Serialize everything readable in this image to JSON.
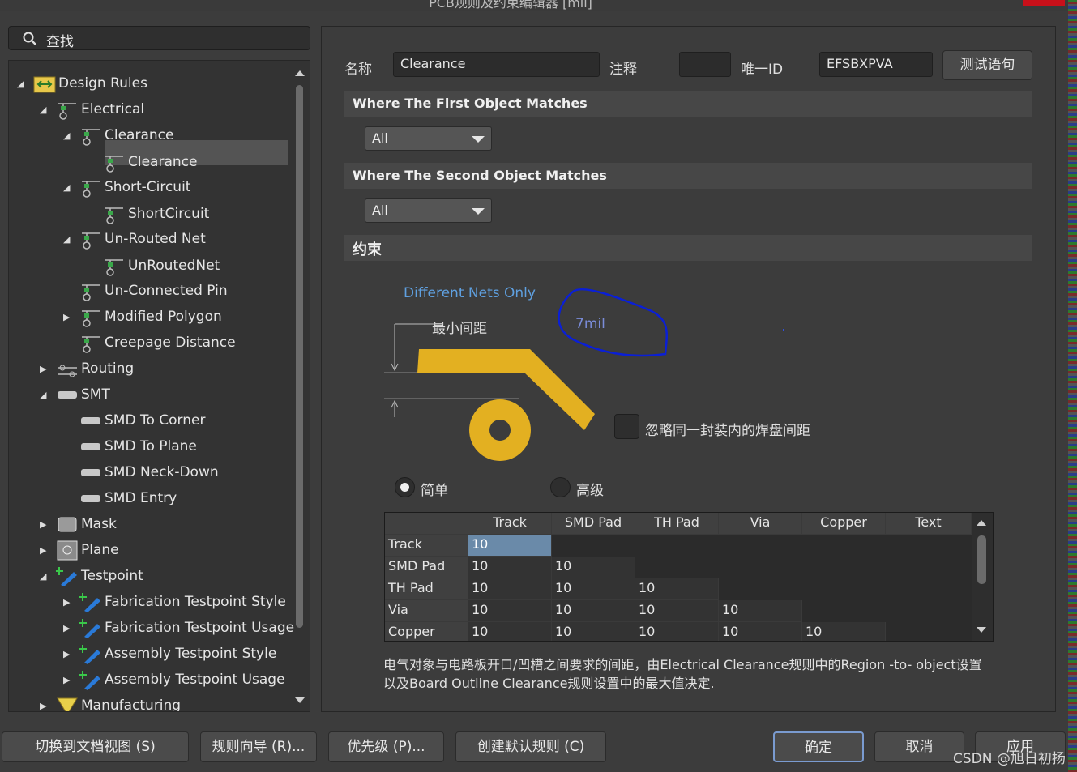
{
  "window": {
    "title": "PCB规则及约束编辑器 [mil]"
  },
  "search": {
    "label": "查找"
  },
  "tree": [
    {
      "label": "Design Rules",
      "icon": "design-rules-icon",
      "state": "expanded"
    },
    {
      "label": "Electrical",
      "icon": "rule-icon",
      "state": "expanded"
    },
    {
      "label": "Clearance",
      "icon": "rule-icon",
      "state": "expanded"
    },
    {
      "label": "Clearance",
      "icon": "rule-icon",
      "state": "leaf",
      "selected": true
    },
    {
      "label": "Short-Circuit",
      "icon": "rule-icon",
      "state": "expanded"
    },
    {
      "label": "ShortCircuit",
      "icon": "rule-icon",
      "state": "leaf"
    },
    {
      "label": "Un-Routed Net",
      "icon": "rule-icon",
      "state": "expanded"
    },
    {
      "label": "UnRoutedNet",
      "icon": "rule-icon",
      "state": "leaf"
    },
    {
      "label": "Un-Connected Pin",
      "icon": "rule-icon",
      "state": "leaf"
    },
    {
      "label": "Modified Polygon",
      "icon": "rule-icon",
      "state": "collapsed"
    },
    {
      "label": "Creepage Distance",
      "icon": "rule-icon",
      "state": "leaf"
    },
    {
      "label": "Routing",
      "icon": "routing-icon",
      "state": "collapsed"
    },
    {
      "label": "SMT",
      "icon": "smt-icon",
      "state": "expanded"
    },
    {
      "label": "SMD To Corner",
      "icon": "smt-icon",
      "state": "leaf"
    },
    {
      "label": "SMD To Plane",
      "icon": "smt-icon",
      "state": "leaf"
    },
    {
      "label": "SMD Neck-Down",
      "icon": "smt-icon",
      "state": "leaf"
    },
    {
      "label": "SMD Entry",
      "icon": "smt-icon",
      "state": "leaf"
    },
    {
      "label": "Mask",
      "icon": "mask-icon",
      "state": "collapsed"
    },
    {
      "label": "Plane",
      "icon": "plane-icon",
      "state": "collapsed"
    },
    {
      "label": "Testpoint",
      "icon": "testpoint-icon",
      "state": "expanded"
    },
    {
      "label": "Fabrication Testpoint Style",
      "icon": "testpoint-icon",
      "state": "collapsed"
    },
    {
      "label": "Fabrication Testpoint Usage",
      "icon": "testpoint-icon",
      "state": "collapsed"
    },
    {
      "label": "Assembly Testpoint Style",
      "icon": "testpoint-icon",
      "state": "collapsed"
    },
    {
      "label": "Assembly Testpoint Usage",
      "icon": "testpoint-icon",
      "state": "collapsed"
    },
    {
      "label": "Manufacturing",
      "icon": "manufacturing-icon",
      "state": "collapsed"
    }
  ],
  "rule": {
    "name_label": "名称",
    "name_value": "Clearance",
    "comment_label": "注释",
    "comment_value": "",
    "uid_label": "唯一ID",
    "uid_value": "EFSBXPVA",
    "test_button": "测试语句"
  },
  "first_match": {
    "title": "Where The First Object Matches",
    "selected": "All"
  },
  "second_match": {
    "title": "Where The Second Object Matches",
    "selected": "All"
  },
  "constraints": {
    "title": "约束",
    "net_scope": "Different Nets Only",
    "min_clearance_label": "最小间距",
    "min_clearance_value": "7mil",
    "ignore_pads_label": "忽略同一封装内的焊盘间距",
    "ignore_pads_checked": false,
    "mode_simple": "简单",
    "mode_advanced": "高级",
    "mode_selected": "simple",
    "annotation_color": "#0a1fd6",
    "copper_color": "#e3b021"
  },
  "matrix": {
    "columns": [
      "Track",
      "SMD Pad",
      "TH Pad",
      "Via",
      "Copper",
      "Text"
    ],
    "rows": [
      {
        "label": "Track",
        "values": [
          "10",
          "",
          "",
          "",
          "",
          ""
        ]
      },
      {
        "label": "SMD Pad",
        "values": [
          "10",
          "10",
          "",
          "",
          "",
          ""
        ]
      },
      {
        "label": "TH Pad",
        "values": [
          "10",
          "10",
          "10",
          "",
          "",
          ""
        ]
      },
      {
        "label": "Via",
        "values": [
          "10",
          "10",
          "10",
          "10",
          "",
          ""
        ]
      },
      {
        "label": "Copper",
        "values": [
          "10",
          "10",
          "10",
          "10",
          "10",
          ""
        ]
      }
    ]
  },
  "description": {
    "line1": "电气对象与电路板开口/凹槽之间要求的间距，由Electrical Clearance规则中的Region -to- object设置",
    "line2": "以及Board Outline Clearance规则设置中的最大值决定."
  },
  "buttons": {
    "switch_doc_view": "切换到文档视图 (S)",
    "rule_wizard": "规则向导 (R)...",
    "priority": "优先级 (P)...",
    "create_default": "创建默认规则 (C)",
    "ok": "确定",
    "cancel": "取消",
    "apply": "应用"
  },
  "watermark": "CSDN @旭日初扬"
}
